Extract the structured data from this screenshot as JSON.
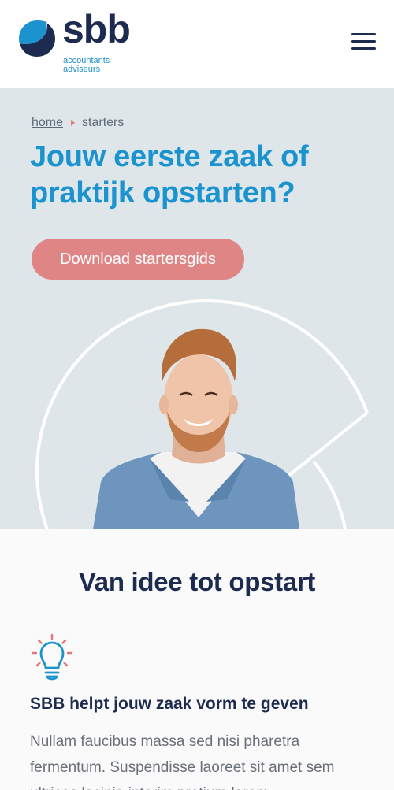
{
  "header": {
    "logo_word": "sbb",
    "logo_sub_line1": "accountants",
    "logo_sub_line2": "adviseurs",
    "menu_icon": "hamburger-menu-icon"
  },
  "breadcrumb": {
    "home": "home",
    "current": "starters",
    "separator_icon": "caret-right-icon"
  },
  "hero": {
    "title": "Jouw eerste zaak of praktijk opstarten?",
    "cta_label": "Download startersgids",
    "image": "smiling young man in denim shirt"
  },
  "section": {
    "title": "Van idee tot opstart"
  },
  "feature": {
    "icon": "lightbulb-icon",
    "title": "SBB helpt jouw zaak vorm te geven",
    "text": "Nullam faucibus massa sed nisi pharetra fermentum. Suspendisse laoreet sit amet sem ultrices lacinia interim pretium lorem"
  },
  "colors": {
    "brand_dark": "#1c2b4f",
    "brand_blue": "#1b93cf",
    "cta": "#df8585",
    "hero_bg": "#dfe6ea"
  }
}
